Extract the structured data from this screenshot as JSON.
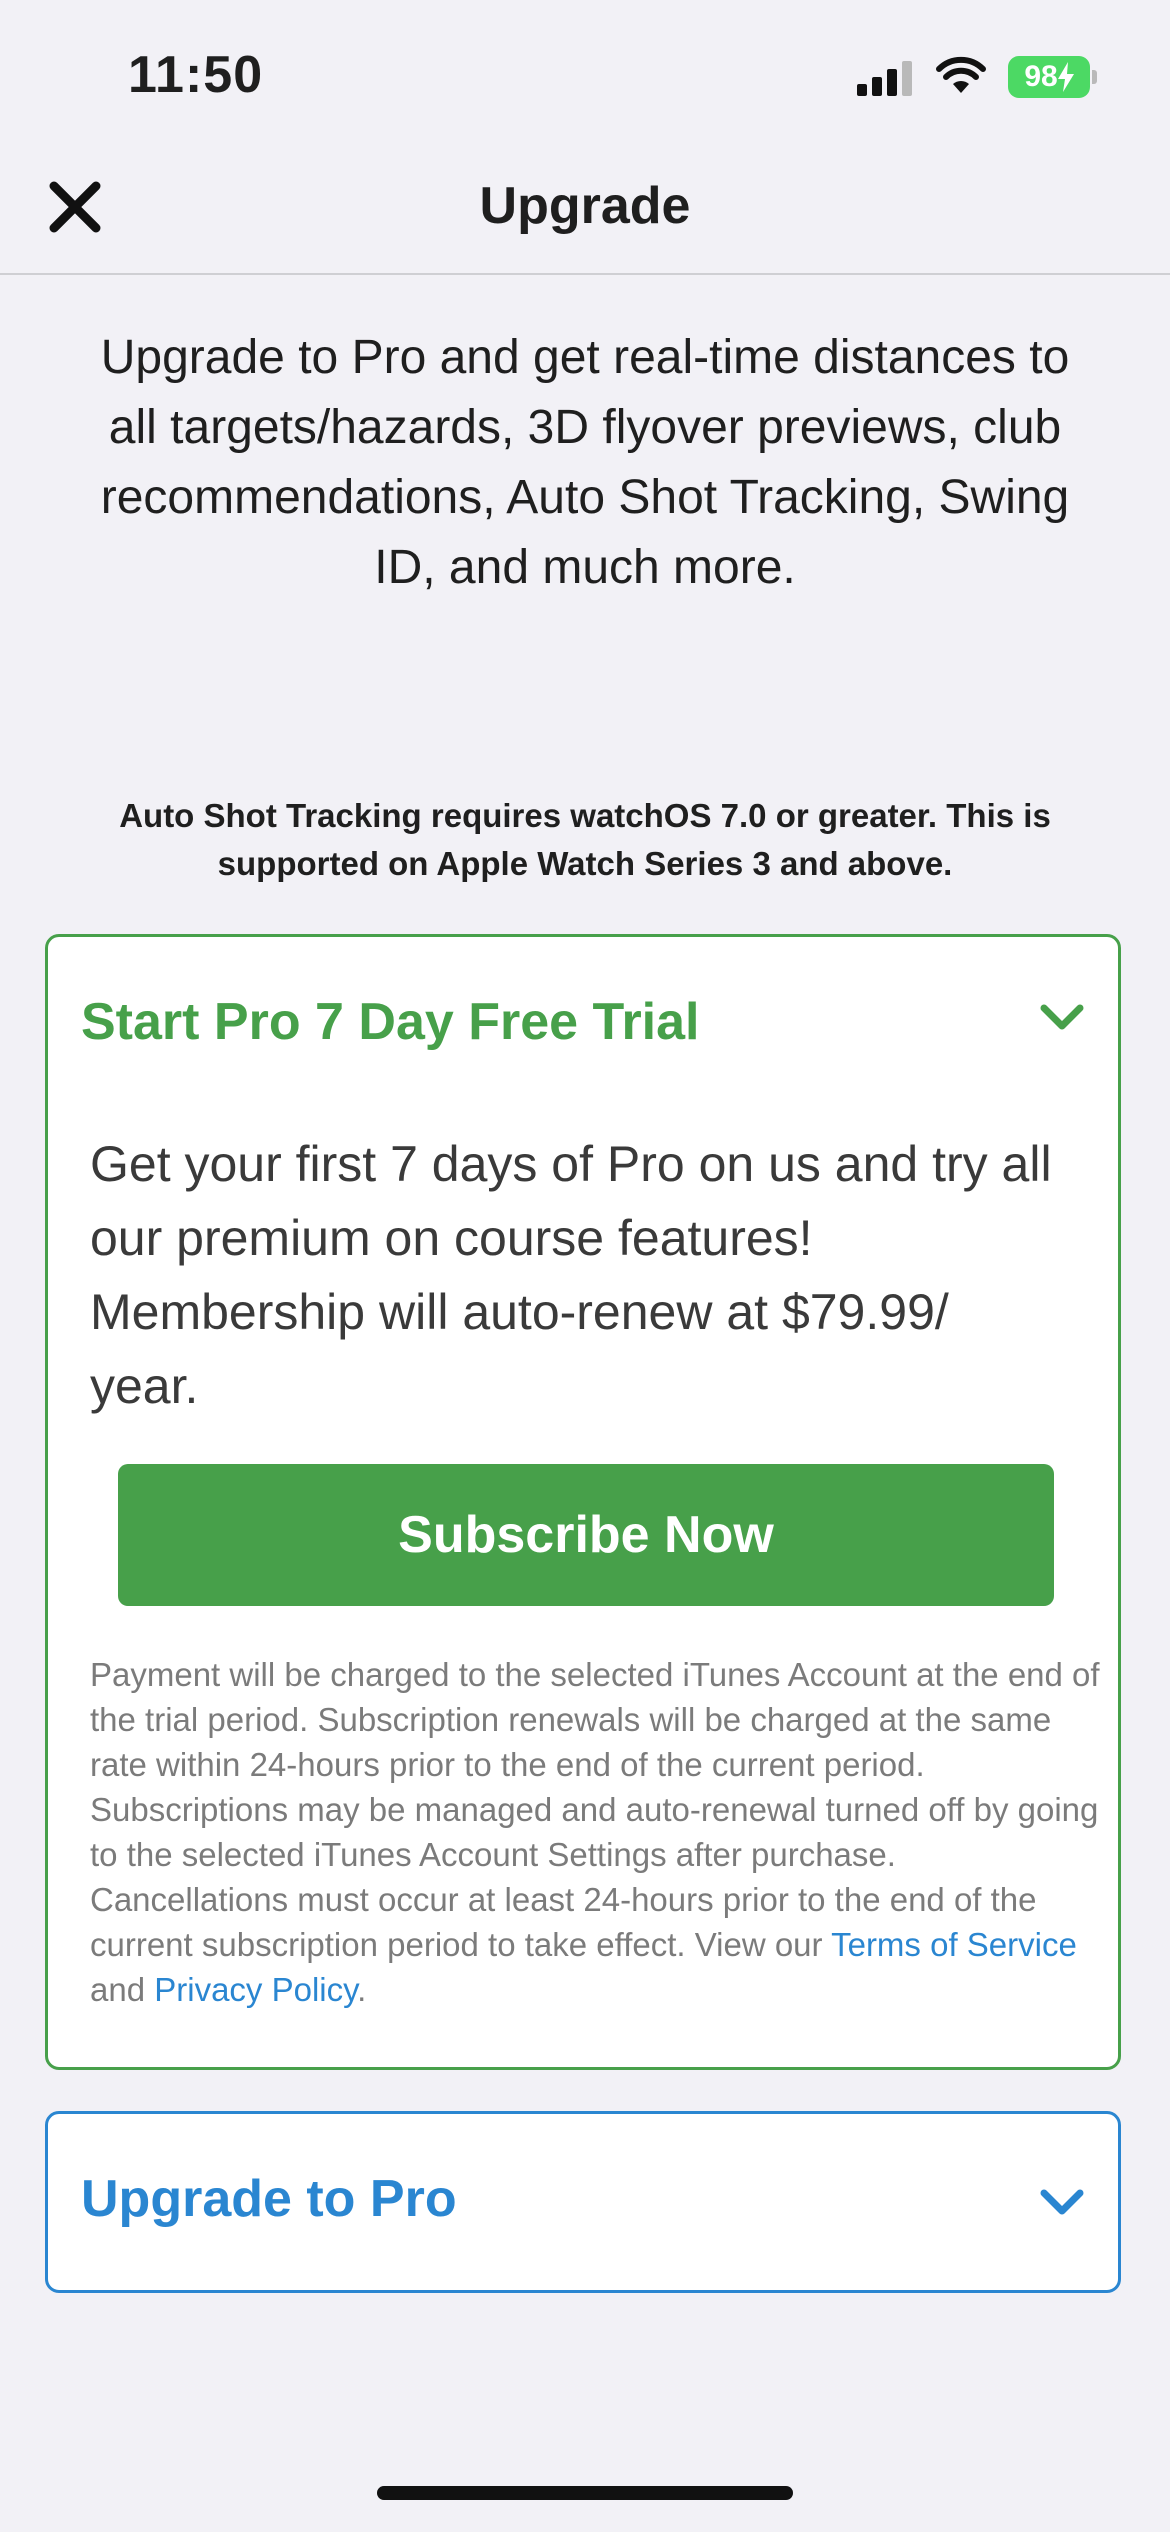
{
  "status_bar": {
    "time": "11:50",
    "battery": "98"
  },
  "nav": {
    "title": "Upgrade"
  },
  "intro": "Upgrade to Pro and get real-time distances to all targets/hazards, 3D flyover previews, club recommendations, Auto Shot Tracking, Swing ID, and much more.",
  "note": "Auto Shot Tracking requires watchOS 7.0 or greater. This is supported on Apple Watch Series 3 and above.",
  "trial_card": {
    "title": "Start Pro 7 Day Free Trial",
    "body": "Get your first 7 days of Pro on us and try all our premium on course features! Membership will auto-renew at $79.99/ year.",
    "button": "Subscribe Now",
    "legal_text": "Payment will be charged to the selected iTunes Account at the end of the trial period. Subscription renewals will be charged at the same rate within 24-hours prior to the end of the current period. Subscriptions may be managed and auto-renewal turned off by going to the selected iTunes Account Settings after purchase. Cancellations must occur at least 24-hours prior to the end of the current subscription period to take effect. View our",
    "terms_link": "Terms of Service",
    "and_text": "and",
    "privacy_link": "Privacy Policy",
    "period": "."
  },
  "pro_card": {
    "title": "Upgrade to Pro"
  },
  "colors": {
    "green": "#47a04a",
    "blue": "#2a86d1",
    "background": "#f2f1f6"
  },
  "icons": [
    "close-icon",
    "chevron-down-icon",
    "signal-icon",
    "wifi-icon",
    "battery-icon",
    "charging-icon"
  ]
}
